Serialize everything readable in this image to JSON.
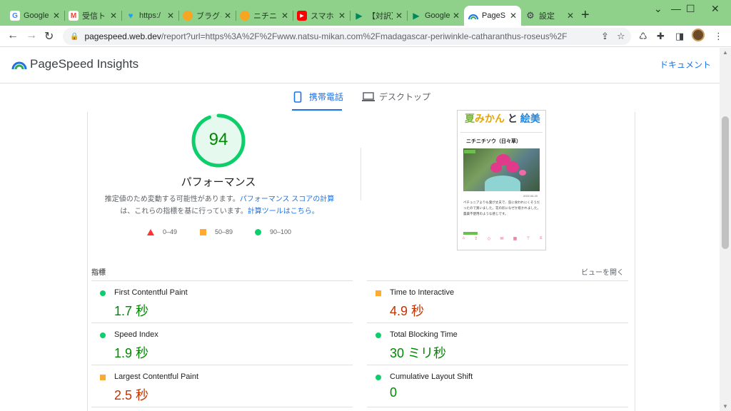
{
  "browser": {
    "tabs": [
      {
        "title": "Google",
        "fav": "google-icon",
        "color": "#4285f4"
      },
      {
        "title": "受信ト",
        "fav": "gmail-icon",
        "color": "#ea4335"
      },
      {
        "title": "https:/",
        "fav": "twitter-icon",
        "color": "#1da1f2"
      },
      {
        "title": "ブラグィ",
        "fav": "natsu-mikan-icon",
        "color": "#f5a623"
      },
      {
        "title": "ニチニ",
        "fav": "natsu-mikan-icon",
        "color": "#f5a623"
      },
      {
        "title": "スマホ",
        "fav": "youtube-icon",
        "color": "#ff0000"
      },
      {
        "title": "【対訳】",
        "fav": "play-icon",
        "color": "#01875f"
      },
      {
        "title": "Google",
        "fav": "play-icon",
        "color": "#01875f"
      },
      {
        "title": "PageS",
        "fav": "pagespeed-icon",
        "color": "#1a73e8"
      },
      {
        "title": "設定",
        "fav": "gear-icon",
        "color": "#3c4043"
      }
    ],
    "url_host": "pagespeed.web.dev",
    "url_rest": "/report?url=https%3A%2F%2Fwww.natsu-mikan.com%2Fmadagascar-periwinkle-catharanthus-roseus%2F"
  },
  "header": {
    "title": "PageSpeed Insights",
    "doc_link": "ドキュメント"
  },
  "device_tabs": {
    "mobile": "携帯電話",
    "desktop": "デスクトップ"
  },
  "score": {
    "value": "94",
    "score_fraction": 0.94,
    "label": "パフォーマンス",
    "note_part1": "推定値のため変動する可能性があります。",
    "note_link1": "パフォーマンス スコアの計算",
    "note_part2": "は、これらの指標を基に行っています。",
    "note_link2": "計算ツールはこちら。"
  },
  "legend": {
    "poor": "0–49",
    "average": "50–89",
    "good": "90–100"
  },
  "phone_preview": {
    "logo_1": "夏",
    "logo_2": "みかん",
    "logo_3": "と",
    "logo_4": "絵美",
    "post_title": "ニチニチソウ（日々草）",
    "date": "2022.06.20",
    "excerpt": "ペチュニアよりも葉が丈夫で、虫に食われにくそうだったので買いました。花の形になぜか惹かれました。農薬不使用のような感じです。"
  },
  "metrics": {
    "label": "指標",
    "toggle": "ビューを開く",
    "items": [
      {
        "name": "First Contentful Paint",
        "value": "1.7 秒",
        "status": "good"
      },
      {
        "name": "Time to Interactive",
        "value": "4.9 秒",
        "status": "avg"
      },
      {
        "name": "Speed Index",
        "value": "1.9 秒",
        "status": "good"
      },
      {
        "name": "Total Blocking Time",
        "value": "30 ミリ秒",
        "status": "good"
      },
      {
        "name": "Largest Contentful Paint",
        "value": "2.5 秒",
        "status": "avg"
      },
      {
        "name": "Cumulative Layout Shift",
        "value": "0",
        "status": "good"
      }
    ]
  },
  "colors": {
    "good": "#0cce6b",
    "average": "#ffaa33",
    "poor": "#ff3333",
    "accent": "#1a73e8",
    "tabstrip": "#8fd08b"
  }
}
